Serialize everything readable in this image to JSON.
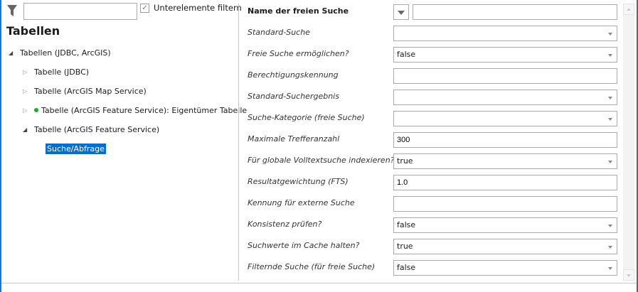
{
  "filter": {
    "search_value": "",
    "subelements_checked": true,
    "subelements_label": "Unterelemente filtern"
  },
  "tree": {
    "title": "Tabellen",
    "items": [
      {
        "label": "Tabellen (JDBC, ArcGIS)",
        "expanded": true
      },
      {
        "label": "Tabelle (JDBC)",
        "expanded": false
      },
      {
        "label": "Tabelle (ArcGIS Map Service)",
        "expanded": false
      },
      {
        "label": "Tabelle (ArcGIS Feature Service): Eigentümer Tabelle",
        "expanded": false,
        "status": "green"
      },
      {
        "label": "Tabelle (ArcGIS Feature Service)",
        "expanded": true
      },
      {
        "label": "Suche/Abfrage",
        "selected": true
      }
    ]
  },
  "properties": [
    {
      "label": "Name der freien Suche",
      "value": ""
    },
    {
      "label": "Standard-Suche",
      "value": ""
    },
    {
      "label": "Freie Suche ermöglichen?",
      "value": "false"
    },
    {
      "label": "Berechtigungskennung",
      "value": ""
    },
    {
      "label": "Standard-Suchergebnis",
      "value": ""
    },
    {
      "label": "Suche-Kategorie (freie Suche)",
      "value": ""
    },
    {
      "label": "Maximale Trefferanzahl",
      "value": "300"
    },
    {
      "label": "Für globale Volltextsuche indexieren?",
      "value": "true"
    },
    {
      "label": "Resultatgewichtung (FTS)",
      "value": "1.0"
    },
    {
      "label": "Kennung für externe Suche",
      "value": ""
    },
    {
      "label": "Konsistenz prüfen?",
      "value": "false"
    },
    {
      "label": "Suchwerte im Cache halten?",
      "value": "true"
    },
    {
      "label": "Filternde Suche (für freie Suche)",
      "value": "false"
    }
  ],
  "colors": {
    "accent": "#1979ca",
    "selection": "#0a6ec8",
    "status_green": "#1faa2e"
  }
}
